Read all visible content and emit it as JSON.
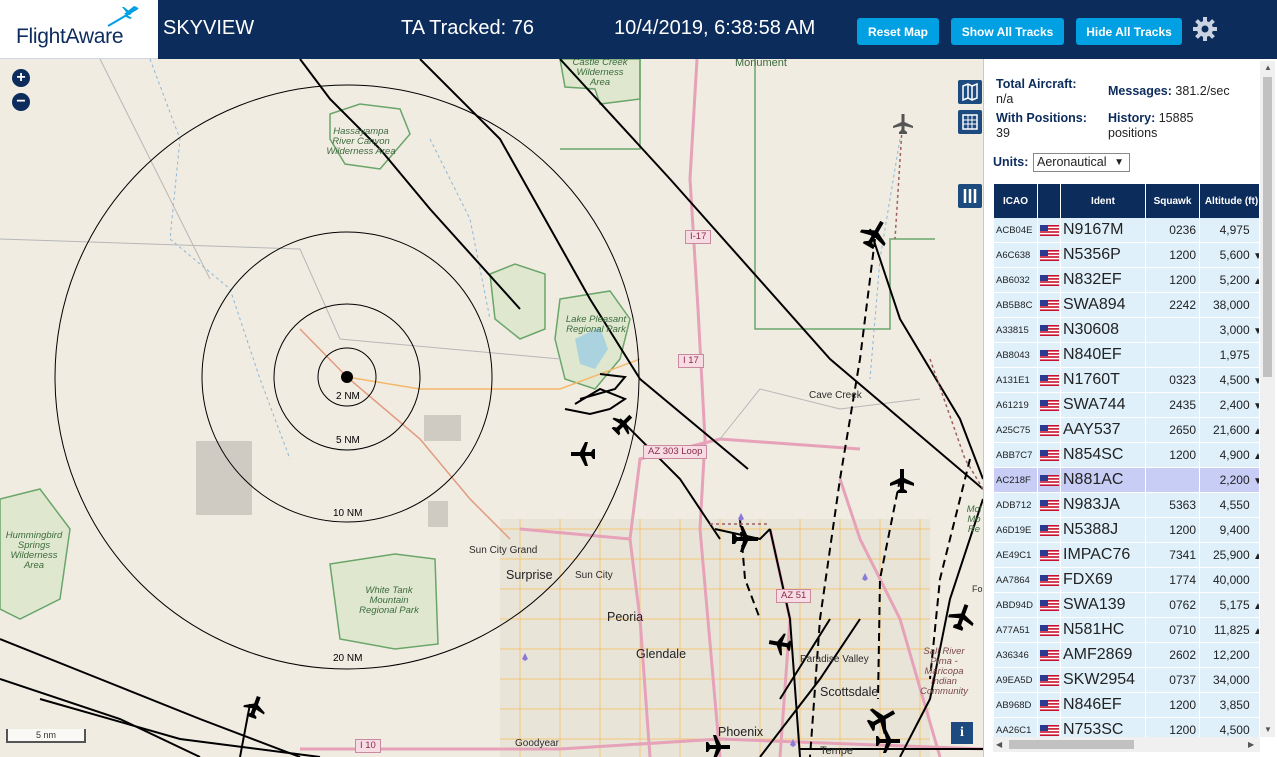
{
  "header": {
    "logo_text": "FlightAware",
    "app_name": "SKYVIEW",
    "ta_tracked": "TA Tracked: 76",
    "datetime": "10/4/2019, 6:38:58 AM",
    "buttons": {
      "reset_map": "Reset Map",
      "show_all_tracks": "Show All Tracks",
      "hide_all_tracks": "Hide All Tracks"
    },
    "settings_icon": "gear-icon"
  },
  "map": {
    "zoom_in": "+",
    "zoom_out": "−",
    "scale_label": "5 nm",
    "info_label": "i",
    "range_rings": [
      "2 NM",
      "5 NM",
      "10 NM",
      "20 NM"
    ],
    "place_labels": {
      "castle_creek": "Castle Creek Wilderness Area",
      "monument": "Monument",
      "hassayampa": "Hassayampa River Canyon Wilderness Area",
      "lake_pleasant": "Lake Pleasant Regional Park",
      "cave_creek": "Cave Creek",
      "hummingbird": "Hummingbird Springs Wilderness Area",
      "white_tank": "White Tank Mountain Regional Park",
      "sun_city_grand": "Sun City Grand",
      "surprise": "Surprise",
      "sun_city": "Sun City",
      "peoria": "Peoria",
      "glendale": "Glendale",
      "paradise_valley": "Paradise Valley",
      "scottsdale": "Scottsdale",
      "salt_river": "Salt River Pima - Maricopa Indian Community",
      "phoenix": "Phoenix",
      "goodyear": "Goodyear",
      "tempe": "Tempe",
      "mcdowell": "Mcl Mo Re",
      "fo": "Fo"
    },
    "road_shields": [
      "I-17",
      "I 17",
      "AZ 303 Loop",
      "AZ 51",
      "I 10"
    ],
    "controls": [
      "map-layers-icon",
      "grid-icon",
      "columns-icon"
    ]
  },
  "panel": {
    "total_aircraft_label": "Total Aircraft:",
    "total_aircraft_value": "n/a",
    "with_positions_label": "With Positions:",
    "with_positions_value": "39",
    "messages_label": "Messages:",
    "messages_value": "381.2/sec",
    "history_label": "History:",
    "history_value": "15885 positions",
    "units_label": "Units:",
    "units_value": "Aeronautical",
    "columns": [
      "ICAO",
      "",
      "Ident",
      "Squawk",
      "Altitude (ft)"
    ],
    "rows": [
      {
        "icao": "ACB04E",
        "ident": "N9167M",
        "squawk": "0236",
        "alt": "4,975",
        "trend": ""
      },
      {
        "icao": "A6C638",
        "ident": "N5356P",
        "squawk": "1200",
        "alt": "5,600",
        "trend": "▼"
      },
      {
        "icao": "AB6032",
        "ident": "N832EF",
        "squawk": "1200",
        "alt": "5,200",
        "trend": "▲"
      },
      {
        "icao": "AB5B8C",
        "ident": "SWA894",
        "squawk": "2242",
        "alt": "38,000",
        "trend": ""
      },
      {
        "icao": "A33815",
        "ident": "N30608",
        "squawk": "",
        "alt": "3,000",
        "trend": "▼"
      },
      {
        "icao": "AB8043",
        "ident": "N840EF",
        "squawk": "",
        "alt": "1,975",
        "trend": ""
      },
      {
        "icao": "A131E1",
        "ident": "N1760T",
        "squawk": "0323",
        "alt": "4,500",
        "trend": "▼"
      },
      {
        "icao": "A61219",
        "ident": "SWA744",
        "squawk": "2435",
        "alt": "2,400",
        "trend": "▼"
      },
      {
        "icao": "A25C75",
        "ident": "AAY537",
        "squawk": "2650",
        "alt": "21,600",
        "trend": "▲"
      },
      {
        "icao": "ABB7C7",
        "ident": "N854SC",
        "squawk": "1200",
        "alt": "4,900",
        "trend": "▲"
      },
      {
        "icao": "AC218F",
        "ident": "N881AC",
        "squawk": "",
        "alt": "2,200",
        "trend": "▼"
      },
      {
        "icao": "ADB712",
        "ident": "N983JA",
        "squawk": "5363",
        "alt": "4,550",
        "trend": ""
      },
      {
        "icao": "A6D19E",
        "ident": "N5388J",
        "squawk": "1200",
        "alt": "9,400",
        "trend": ""
      },
      {
        "icao": "AE49C1",
        "ident": "IMPAC76",
        "squawk": "7341",
        "alt": "25,900",
        "trend": "▲"
      },
      {
        "icao": "AA7864",
        "ident": "FDX69",
        "squawk": "1774",
        "alt": "40,000",
        "trend": ""
      },
      {
        "icao": "ABD94D",
        "ident": "SWA139",
        "squawk": "0762",
        "alt": "5,175",
        "trend": "▲"
      },
      {
        "icao": "A77A51",
        "ident": "N581HC",
        "squawk": "0710",
        "alt": "11,825",
        "trend": "▲"
      },
      {
        "icao": "A36346",
        "ident": "AMF2869",
        "squawk": "2602",
        "alt": "12,200",
        "trend": ""
      },
      {
        "icao": "A9EA5D",
        "ident": "SKW2954",
        "squawk": "0737",
        "alt": "34,000",
        "trend": ""
      },
      {
        "icao": "AB968D",
        "ident": "N846EF",
        "squawk": "1200",
        "alt": "3,850",
        "trend": ""
      },
      {
        "icao": "AA26C1",
        "ident": "N753SC",
        "squawk": "1200",
        "alt": "4,500",
        "trend": ""
      }
    ],
    "selected_icao": "AC218F"
  },
  "colors": {
    "header_bg": "#0c2c5c",
    "button_bg": "#00a0e3",
    "row_bg": "#dff0fb",
    "row_selected": "#c7cdf5",
    "map_bg": "#f0ece2",
    "park_green": "#8fbf7a"
  }
}
